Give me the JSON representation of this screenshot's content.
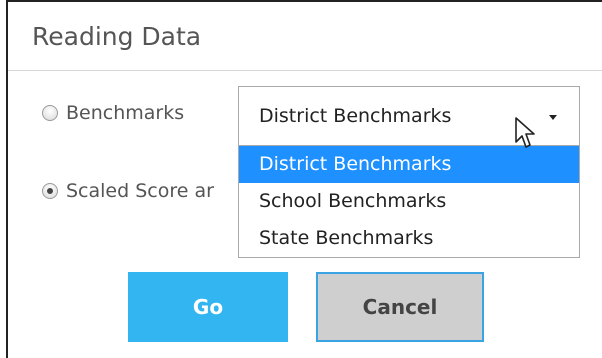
{
  "panel": {
    "title": "Reading Data"
  },
  "options": {
    "benchmarks_label": "Benchmarks",
    "scaled_score_label": "Scaled Score ar"
  },
  "select": {
    "value": "District Benchmarks",
    "items": [
      "District Benchmarks",
      "School Benchmarks",
      "State Benchmarks"
    ]
  },
  "buttons": {
    "go": "Go",
    "cancel": "Cancel"
  },
  "colors": {
    "go_button": "#33b5f2",
    "selected_option": "#1e90ff",
    "cancel_button": "#cfcfcf"
  }
}
